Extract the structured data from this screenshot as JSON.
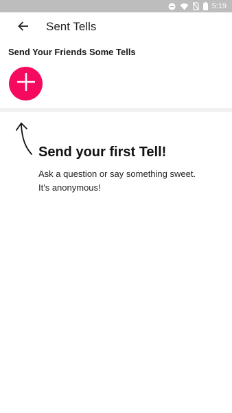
{
  "status_bar": {
    "time": "5:19",
    "icons": [
      "dnd-icon",
      "wifi-icon",
      "no-sim-icon",
      "battery-icon"
    ]
  },
  "app_bar": {
    "title": "Sent Tells",
    "back_icon": "arrow-left-icon"
  },
  "compose": {
    "section_title": "Send Your Friends Some Tells",
    "add_icon": "plus-icon",
    "accent_color": "#f50a60"
  },
  "empty_state": {
    "title": "Send your first Tell!",
    "line1": "Ask a question or say something sweet.",
    "line2": "It's anonymous!",
    "arrow_icon": "hand-drawn-up-arrow-icon"
  }
}
